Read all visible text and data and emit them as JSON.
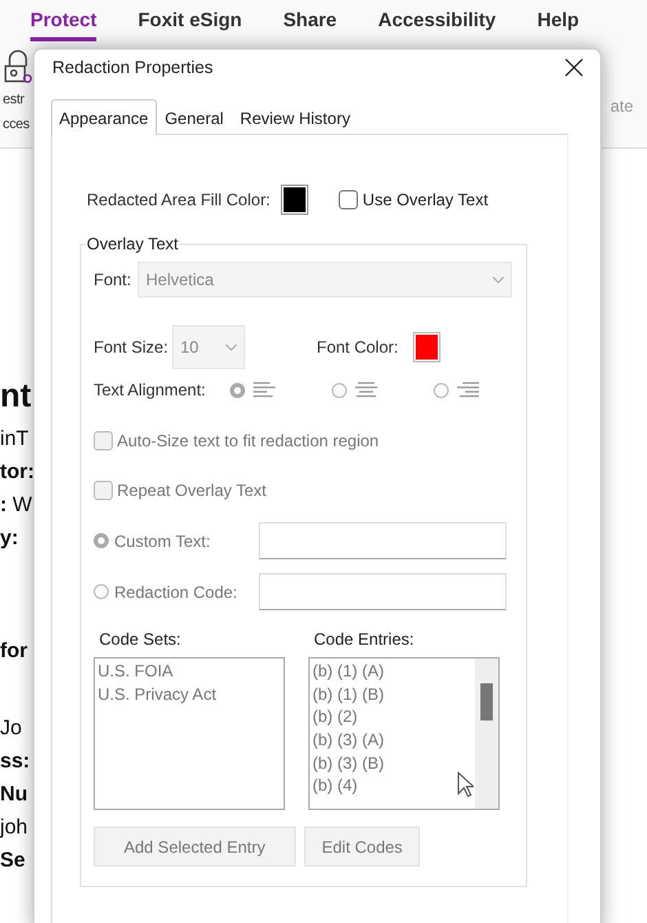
{
  "ribbon": {
    "tabs": [
      {
        "label": "Protect",
        "selected": true
      },
      {
        "label": "Foxit eSign",
        "selected": false
      },
      {
        "label": "Share",
        "selected": false
      },
      {
        "label": "Accessibility",
        "selected": false
      },
      {
        "label": "Help",
        "selected": false
      }
    ],
    "left_label_lines": [
      "estr",
      "cces"
    ],
    "right_label": "ate"
  },
  "document": {
    "lines": [
      {
        "text": "nt",
        "kind": "heading"
      },
      {
        "text": "inT",
        "kind": "text"
      },
      {
        "text": "tor:",
        "kind": "label"
      },
      {
        "text": "**:** W",
        "kind": "text"
      },
      {
        "text": "y:",
        "kind": "label"
      },
      {
        "text": "for",
        "kind": "label"
      },
      {
        "text": "Jo",
        "kind": "text"
      },
      {
        "text": "ss:",
        "kind": "label"
      },
      {
        "text": "Nu",
        "kind": "label"
      },
      {
        "text": "joh",
        "kind": "text"
      },
      {
        "text": "Se",
        "kind": "label"
      }
    ]
  },
  "dialog": {
    "title": "Redaction Properties",
    "tabs": [
      {
        "label": "Appearance",
        "selected": true
      },
      {
        "label": "General",
        "selected": false
      },
      {
        "label": "Review History",
        "selected": false
      }
    ],
    "fill_color_label": "Redacted Area Fill Color:",
    "fill_swatch": {
      "color": "#000000"
    },
    "use_overlay": {
      "label": "Use Overlay Text",
      "checked": false
    },
    "overlay": {
      "legend": "Overlay Text",
      "disabled": true,
      "font_label": "Font:",
      "font_value": "Helvetica",
      "size_label": "Font Size:",
      "size_value": "10",
      "color_label": "Font Color:",
      "font_swatch": {
        "color": "#ff0000"
      },
      "alignment_label": "Text Alignment:",
      "alignments": [
        {
          "kind": "left",
          "selected": true
        },
        {
          "kind": "center",
          "selected": false
        },
        {
          "kind": "right",
          "selected": false
        }
      ],
      "auto_size": {
        "label": "Auto-Size text to fit redaction region",
        "checked": false
      },
      "repeat": {
        "label": "Repeat Overlay Text",
        "checked": false
      },
      "sources": [
        {
          "label": "Custom Text:",
          "selected": true
        },
        {
          "label": "Redaction Code:",
          "selected": false
        }
      ],
      "code_sets_label": "Code Sets:",
      "code_sets": [
        "U.S. FOIA",
        "U.S. Privacy Act"
      ],
      "code_entries_label": "Code Entries:",
      "code_entries": [
        "(b) (1) (A)",
        "(b) (1) (B)",
        "(b) (2)",
        "(b) (3) (A)",
        "(b) (3) (B)",
        "(b) (4)"
      ],
      "buttons": [
        "Add Selected Entry",
        "Edit Codes"
      ]
    }
  }
}
